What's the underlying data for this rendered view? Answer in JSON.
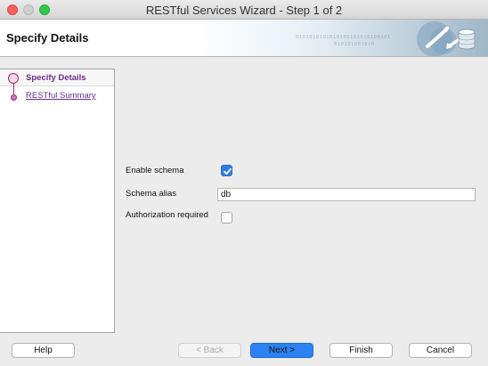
{
  "window": {
    "title": "RESTful Services Wizard - Step 1 of 2"
  },
  "header": {
    "title": "Specify Details",
    "binary_1": "0101010101010100101010100101",
    "binary_2": "010101001010"
  },
  "steps": [
    {
      "label": "Specify Details",
      "state": "current"
    },
    {
      "label": "RESTful Summary",
      "state": "link"
    }
  ],
  "form": {
    "enable_schema_label": "Enable schema",
    "enable_schema_checked": true,
    "schema_alias_label": "Schema alias",
    "schema_alias_value": "db",
    "authorization_label": "Authorization required",
    "authorization_checked": false
  },
  "buttons": {
    "help": "Help",
    "back": "< Back",
    "next": "Next >",
    "finish": "Finish",
    "cancel": "Cancel"
  },
  "colors": {
    "accent": "#2d82f1",
    "step_link": "#6a2b8f",
    "close": "#fc605b",
    "maximize": "#34c84a"
  }
}
